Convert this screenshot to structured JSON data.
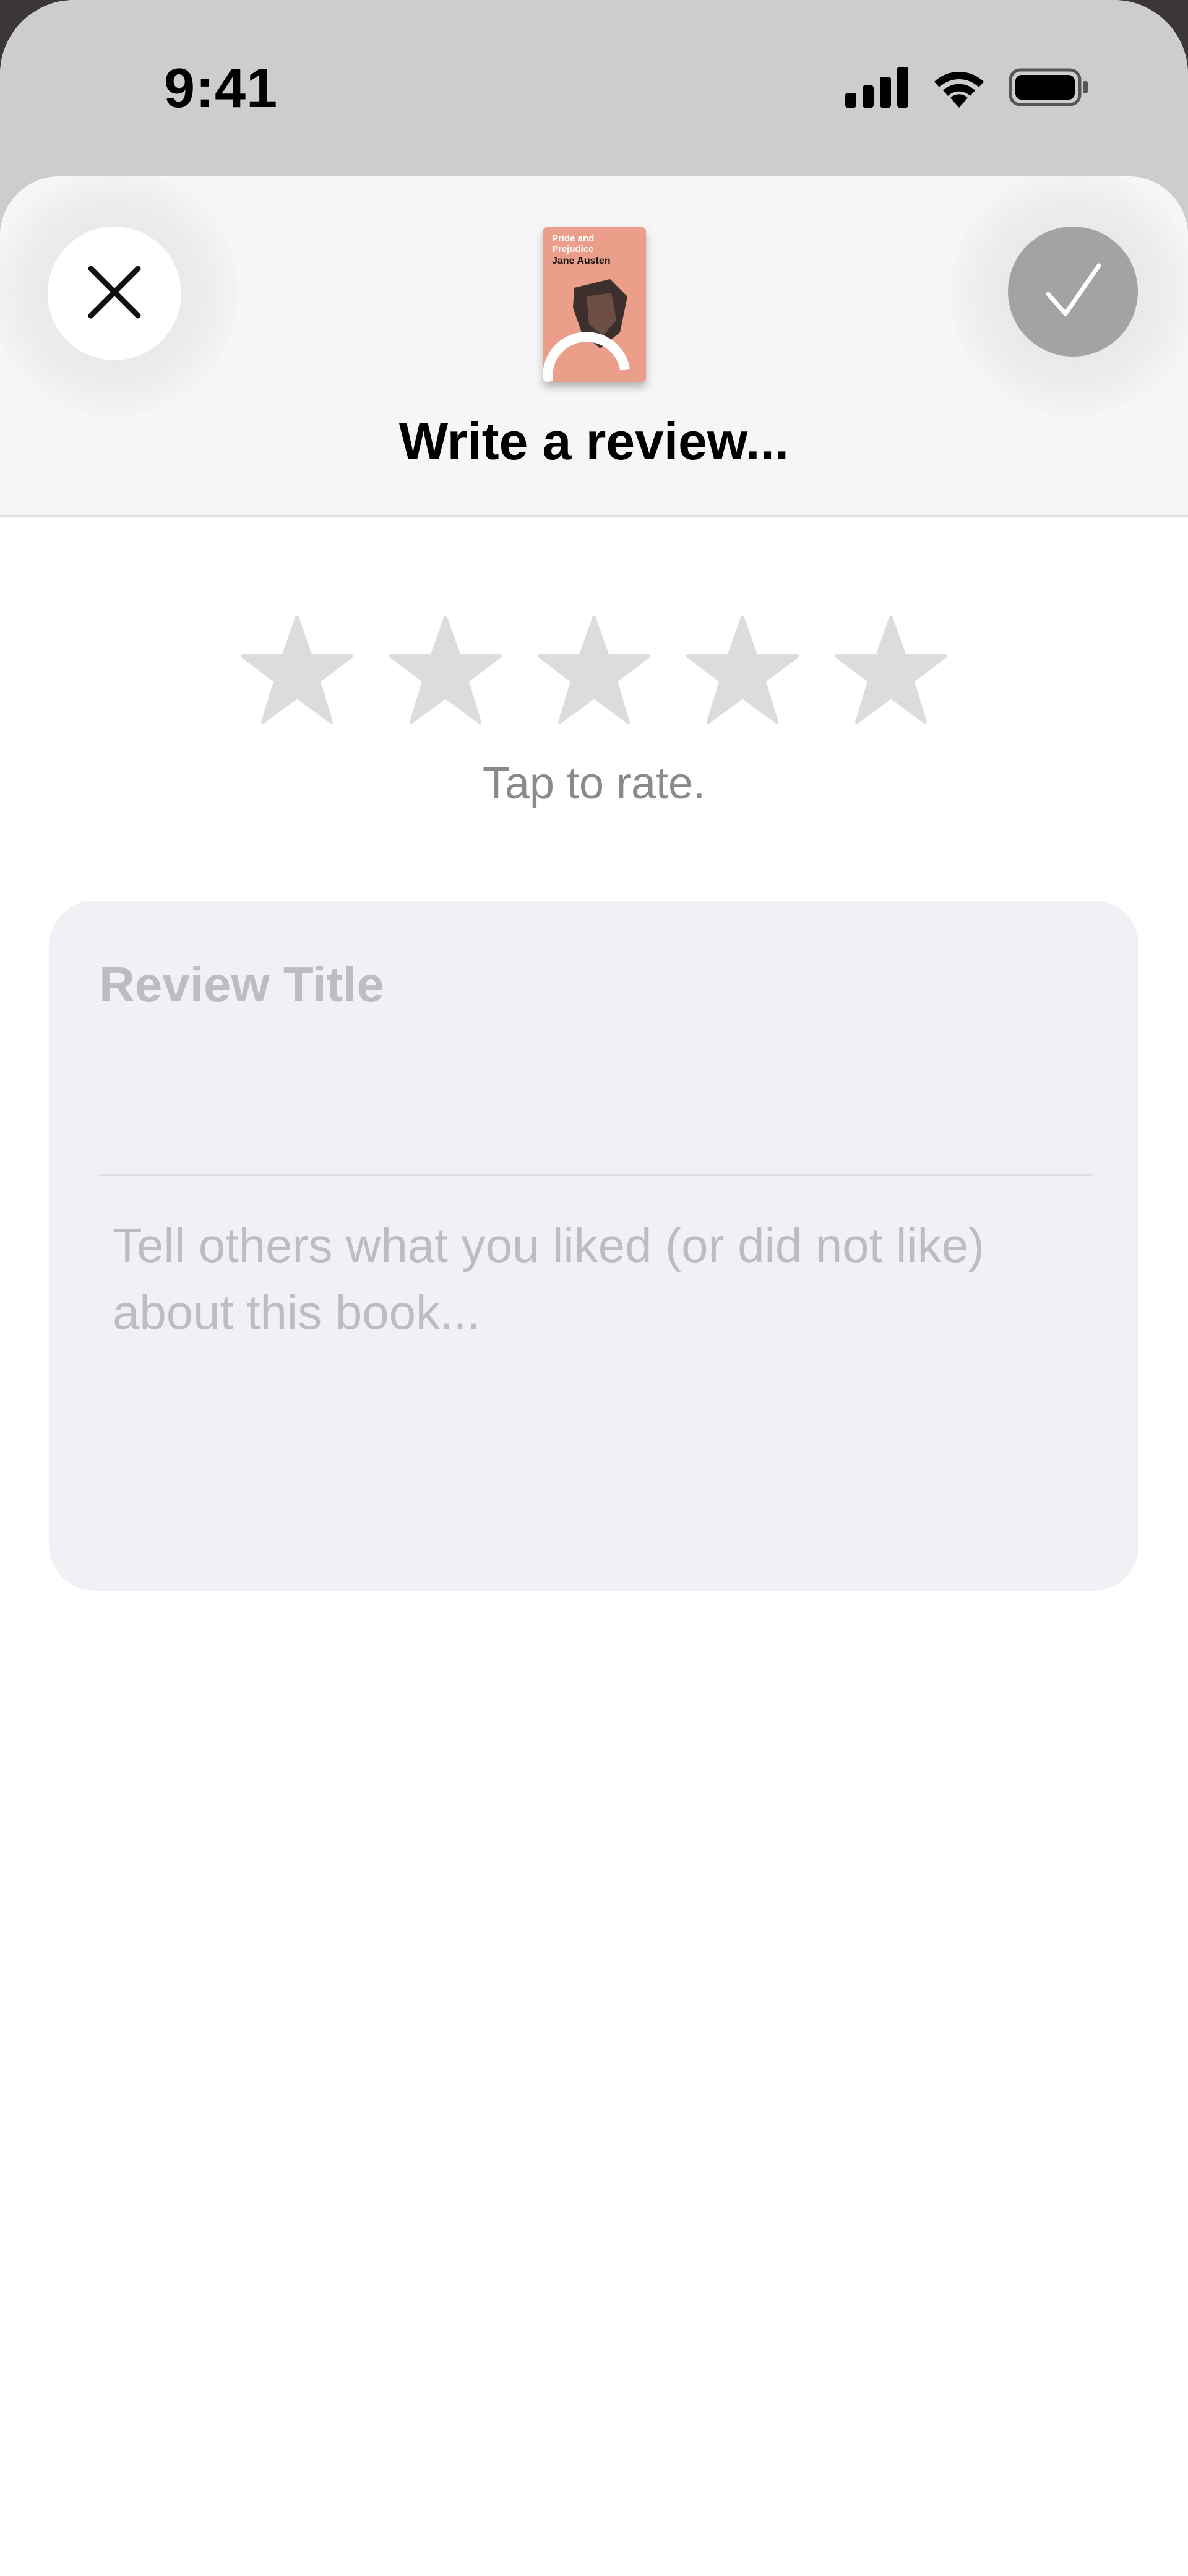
{
  "status_bar": {
    "time": "9:41"
  },
  "header": {
    "title": "Write a review...",
    "close_icon": "close-icon",
    "done_icon": "checkmark-icon",
    "book": {
      "title": "Pride and Prejudice",
      "author": "Jane Austen",
      "cover_color": "#eb9f8b"
    }
  },
  "rating": {
    "star_count": 5,
    "value": 0,
    "hint": "Tap to rate.",
    "empty_color": "#dcdcde"
  },
  "review": {
    "title_placeholder": "Review Title",
    "body_placeholder": "Tell others what you liked (or did not like) about this book..."
  },
  "colors": {
    "backdrop": "#cdcdcd",
    "header_bg": "#f6f6f7",
    "done_button": "#a3a3a3",
    "card_bg": "#f1f1f5",
    "placeholder_text": "#bdbdc1"
  }
}
